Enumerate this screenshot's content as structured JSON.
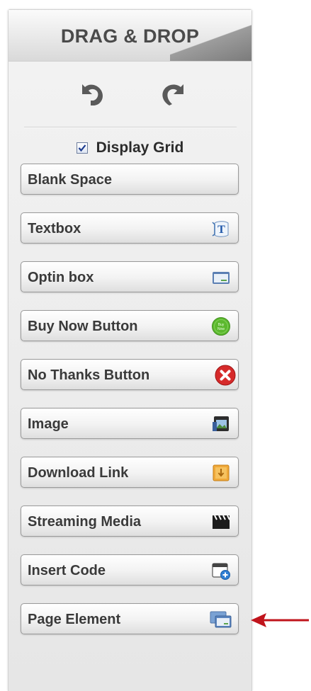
{
  "header": {
    "title": "DRAG & DROP"
  },
  "toolbar": {
    "undo_icon": "undo-icon",
    "redo_icon": "redo-icon"
  },
  "grid": {
    "label": "Display Grid",
    "checked": true
  },
  "buttons": [
    {
      "label": "Blank Space",
      "icon": ""
    },
    {
      "label": "Textbox",
      "icon": "textbox-icon"
    },
    {
      "label": "Optin box",
      "icon": "optin-window-icon"
    },
    {
      "label": "Buy Now Button",
      "icon": "buy-now-badge-icon",
      "icon_text": "Buy Now"
    },
    {
      "label": "No Thanks Button",
      "icon": "close-x-icon"
    },
    {
      "label": "Image",
      "icon": "image-icon"
    },
    {
      "label": "Download Link",
      "icon": "download-box-icon"
    },
    {
      "label": "Streaming Media",
      "icon": "clapperboard-icon"
    },
    {
      "label": "Insert Code",
      "icon": "code-window-add-icon"
    },
    {
      "label": "Page Element",
      "icon": "page-element-windows-icon"
    }
  ],
  "annotation": {
    "arrow_color": "#c0141c"
  },
  "colors": {
    "green_badge": "#5cb82e",
    "red_close": "#d62a2a",
    "download_orange": "#f0a93a"
  }
}
